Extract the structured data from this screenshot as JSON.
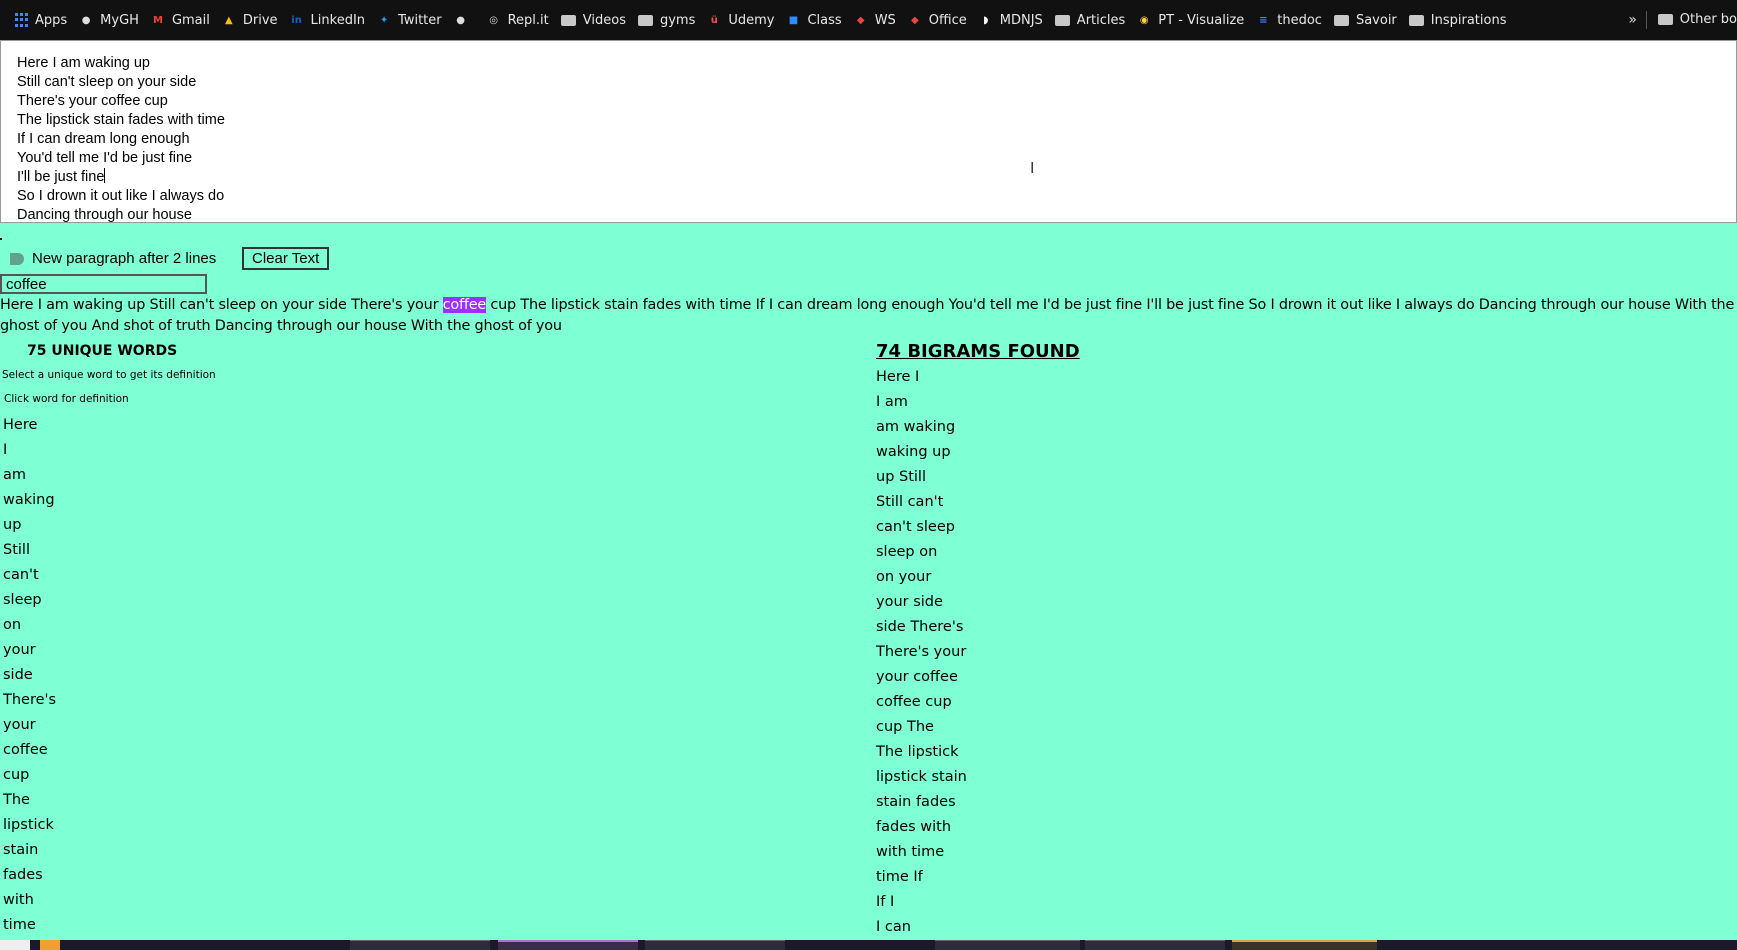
{
  "bookmarks": [
    {
      "label": "Apps",
      "icon": "apps-grid-icon"
    },
    {
      "label": "MyGH",
      "icon": "github-icon"
    },
    {
      "label": "Gmail",
      "icon": "gmail-icon"
    },
    {
      "label": "Drive",
      "icon": "drive-icon"
    },
    {
      "label": "LinkedIn",
      "icon": "linkedin-icon"
    },
    {
      "label": "Twitter",
      "icon": "twitter-icon"
    },
    {
      "label": "",
      "icon": "github-icon"
    },
    {
      "label": "Repl.it",
      "icon": "replit-icon"
    },
    {
      "label": "Videos",
      "icon": "folder-icon"
    },
    {
      "label": "gyms",
      "icon": "folder-icon"
    },
    {
      "label": "Udemy",
      "icon": "udemy-icon"
    },
    {
      "label": "Class",
      "icon": "zoom-icon"
    },
    {
      "label": "WS",
      "icon": "ws-icon"
    },
    {
      "label": "Office",
      "icon": "office-icon"
    },
    {
      "label": "MDNJS",
      "icon": "mdn-icon"
    },
    {
      "label": "Articles",
      "icon": "folder-icon"
    },
    {
      "label": "PT - Visualize",
      "icon": "python-icon"
    },
    {
      "label": "thedoc",
      "icon": "docs-icon"
    },
    {
      "label": "Savoir",
      "icon": "folder-icon"
    },
    {
      "label": "Inspirations",
      "icon": "folder-icon"
    }
  ],
  "bookmarks_more": "»",
  "other_bookmarks": "Other bo",
  "editor": {
    "lines": [
      "Here I am waking up",
      "Still can't sleep on your side",
      "There's your coffee cup",
      "The lipstick stain fades with time",
      "If I can dream long enough",
      "You'd tell me I'd be just fine",
      "I'll be just fine",
      "So I drown it out like I always do",
      "Dancing through our house"
    ]
  },
  "controls": {
    "toggle_label": "New paragraph after 2 lines",
    "clear_label": "Clear Text",
    "search_value": "coffee"
  },
  "output": {
    "before": "Here I am waking up Still can't sleep on your side There's your ",
    "highlight": "coffee",
    "after": " cup The lipstick stain fades with time If I can dream long enough You'd tell me I'd be just fine I'll be just fine So I drown it out like I always do Dancing through our house With the ghost of you And shot of truth Dancing through our house With the ghost of you"
  },
  "unique_words": {
    "title": "75 UNIQUE WORDS",
    "hint_select": "Select a unique word to get its definition",
    "hint_click": "Click word for definition",
    "items": [
      "Here",
      "I",
      "am",
      "waking",
      "up",
      "Still",
      "can't",
      "sleep",
      "on",
      "your",
      "side",
      "There's",
      "your",
      "coffee",
      "cup",
      "The",
      "lipstick",
      "stain",
      "fades",
      "with",
      "time"
    ]
  },
  "bigrams": {
    "title": "74 BIGRAMS FOUND",
    "items": [
      "Here I",
      "I am",
      "am waking",
      "waking up",
      "up Still",
      "Still can't",
      "can't sleep",
      "sleep on",
      "on your",
      "your side",
      "side There's",
      "There's your",
      "your coffee",
      "coffee cup",
      "cup The",
      "The lipstick",
      "lipstick stain",
      "stain fades",
      "fades with",
      "with time",
      "time If",
      "If I",
      "I can"
    ]
  }
}
